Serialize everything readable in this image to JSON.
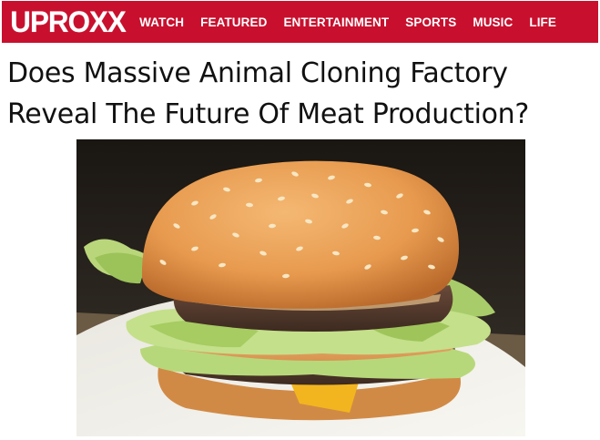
{
  "brand": {
    "logo_text": "UPROXX",
    "nav_color": "#c8102e"
  },
  "nav": {
    "items": [
      {
        "label": "WATCH"
      },
      {
        "label": "FEATURED"
      },
      {
        "label": "ENTERTAINMENT"
      },
      {
        "label": "SPORTS"
      },
      {
        "label": "MUSIC"
      },
      {
        "label": "LIFE"
      }
    ]
  },
  "article": {
    "headline": "Does Massive Animal Cloning Factory Reveal The Future Of Meat Production?",
    "hero_image": "hamburger-photo"
  }
}
